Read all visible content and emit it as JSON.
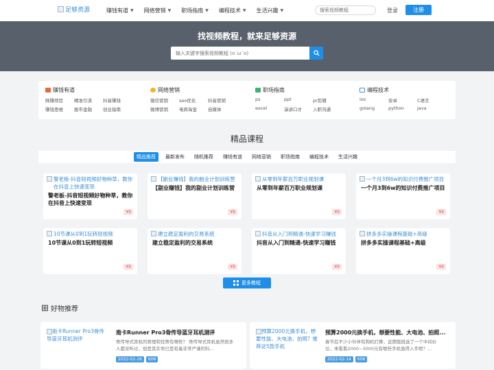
{
  "header": {
    "logo_text": "足够资源",
    "nav": [
      "赚钱有道",
      "网络营销",
      "职场指南",
      "编程技术",
      "生活兴趣"
    ],
    "search_placeholder": "搜索视频教程",
    "login": "登录",
    "register": "注册"
  },
  "hero": {
    "title": "找视频教程，就来足够资源",
    "search_placeholder": "输入关键字搜索视频教程 (o´ω`o)"
  },
  "categories": [
    {
      "name": "赚钱有道",
      "color": "#e8693c",
      "links": [
        "网赚项目",
        "精准引流",
        "抖音赚钱",
        "赚钱思维",
        "股市金融",
        "创业指南"
      ]
    },
    {
      "name": "网络营销",
      "color": "#f0b429",
      "links": [
        "微信营销",
        "seo优化",
        "抖音营销",
        "微博营销",
        "电商淘宝",
        "自媒体"
      ]
    },
    {
      "name": "职场指南",
      "color": "#3cb371",
      "links": [
        "ps",
        "ppt",
        "pr剪辑",
        "excel",
        "演讲口才",
        "入职沟通"
      ]
    },
    {
      "name": "编程技术",
      "color": "#3b8fd6",
      "links": [
        "ios",
        "安卓",
        "C语言",
        "golang",
        "python",
        "java"
      ]
    }
  ],
  "courses": {
    "section_title": "精品课程",
    "tabs": [
      "精品推荐",
      "最新发布",
      "随机推荐",
      "赚钱有道",
      "网络营销",
      "职场指南",
      "编程技术",
      "生活兴趣"
    ],
    "active_tab": "精品推荐",
    "items": [
      {
        "thumb_alt": "警老板-抖音短视频好物种草，教你在抖音上快速变现",
        "title": "警老板-抖音短视频好物种草，教你在抖音上快速变现",
        "price": "¥9"
      },
      {
        "thumb_alt": "【副业赚钱】我的副业计划训练营",
        "title": "【副业赚钱】我的副业计划训练营",
        "price": "¥9"
      },
      {
        "thumb_alt": "从零到年薪百万职业规划课",
        "title": "从零到年薪百万职业规划课",
        "price": "¥9"
      },
      {
        "thumb_alt": "一个月3到6w的知识付费推广项目",
        "title": "一个月3到6w的知识付费推广项目",
        "price": "¥9"
      },
      {
        "thumb_alt": "10节课从0到1玩转短视频",
        "title": "10节课从0到1玩转短视频",
        "price": "¥9"
      },
      {
        "thumb_alt": "建立稳定盈利的交易系统",
        "title": "建立稳定盈利的交易系统",
        "price": "¥9"
      },
      {
        "thumb_alt": "抖音从入门到精通-快速学习赚钱",
        "title": "抖音从入门到精通-快速学习赚钱",
        "price": "¥9"
      },
      {
        "thumb_alt": "拼多多实操课程基础+高级",
        "title": "拼多多实操课程基础+高级",
        "price": "¥9"
      }
    ],
    "more_label": "更多教程"
  },
  "goods": {
    "title": "好物推荐",
    "items": [
      {
        "thumb_alt": "南卡Runner Pro3骨传导蓝牙耳机测评",
        "name": "南卡Runner Pro3骨传导蓝牙耳机测评",
        "desc": "骨传导式耳机的原理和优势有哪些？ 骨传导式耳机虽然很多人都没听过，但是其实早已是有着非常严谨的科...",
        "date": "2022-02-16",
        "views": "606"
      },
      {
        "thumb_alt": "预算2000元换手机，想要性能、大电池、拍照？推荐这5款手机",
        "name": "预算2000元换手机，想要性能、大电池、拍照...",
        "desc": "春节后不少小伙伴有购机打算，这期我挑选了一个中间价位，来看看2000~3000元有哪些手机值得入手呢？...",
        "date": "2022-02-14",
        "views": "606"
      }
    ]
  }
}
